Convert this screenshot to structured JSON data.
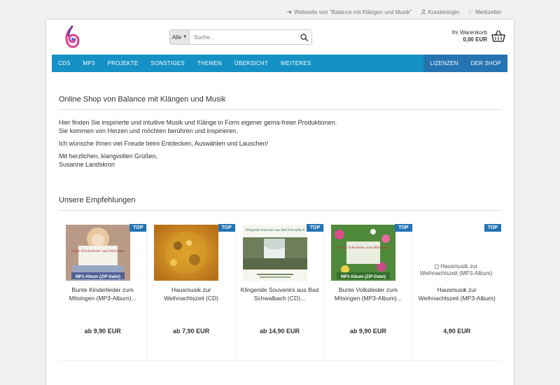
{
  "topbar": {
    "website_link": "Webseite von \"Balance mit Klängen und Musik\"",
    "login": "Kundenlogin",
    "wishlist": "Merkzettel"
  },
  "search": {
    "category": "Alle",
    "placeholder": "Suche..."
  },
  "cart": {
    "label": "Ihr Warenkorb",
    "amount": "0,00 EUR"
  },
  "nav": {
    "items": [
      "CDS",
      "MP3",
      "PROJEKTE",
      "SONSTIGES",
      "THEMEN",
      "ÜBERSICHT",
      "WEITERES"
    ],
    "right": [
      "LIZENZEN",
      "DER SHOP"
    ]
  },
  "intro": {
    "title": "Online Shop von Balance mit Klängen und Musik",
    "line1": "Hier finden Sie inspirierte und intuitive Musik und Klänge in Form eigener gema-freier Produktionen.",
    "line2": "Sie kommen von Herzen und möchten berühren und inspirieren.",
    "line3": "Ich wünsche Ihnen viel Freude beim Entdecken, Auswählen und Lauschen!",
    "line4": "Mit herzlichen, klangvollen Grüßen,",
    "line5": "Susanne Landskron"
  },
  "recommendations": {
    "title": "Unsere Empfehlungen",
    "badge": "TOP",
    "products": [
      {
        "name": "Bunte Kinderlieder zum Mitsingen (MP3-Album)...",
        "price": "ab 9,90 EUR",
        "cover_title": "Bunte Kinderlieder zum Mitsingen",
        "cover_tag": "MP3 Album (ZIP-Datei)"
      },
      {
        "name": "Hausmusik zur Weihnachtszeit (CD)",
        "price": "ab 7,90 EUR"
      },
      {
        "name": "Klingende Souvenirs aus Bad Schwalbach (CD)...",
        "price": "ab 14,90 EUR",
        "cover_title": "Klingende Souvenirs aus Bad Schwalbach"
      },
      {
        "name": "Bunte Volkslieder zum Mitsingen (MP3-Album)...",
        "price": "ab 9,90 EUR",
        "cover_title": "Bunte Volkslieder zum Mitsingen",
        "cover_tag": "MP3 Album (ZIP-Datei)"
      },
      {
        "name": "Hausmusik zur Weihnachtszeit (MP3-Album)",
        "price": "4,90 EUR",
        "alt_text": "Hausmusik zur Weihnachtszeit (MP3-Album)"
      }
    ]
  },
  "colors": {
    "nav": "#1591c5",
    "nav_right": "#2574b1",
    "badge": "#2574b1"
  }
}
